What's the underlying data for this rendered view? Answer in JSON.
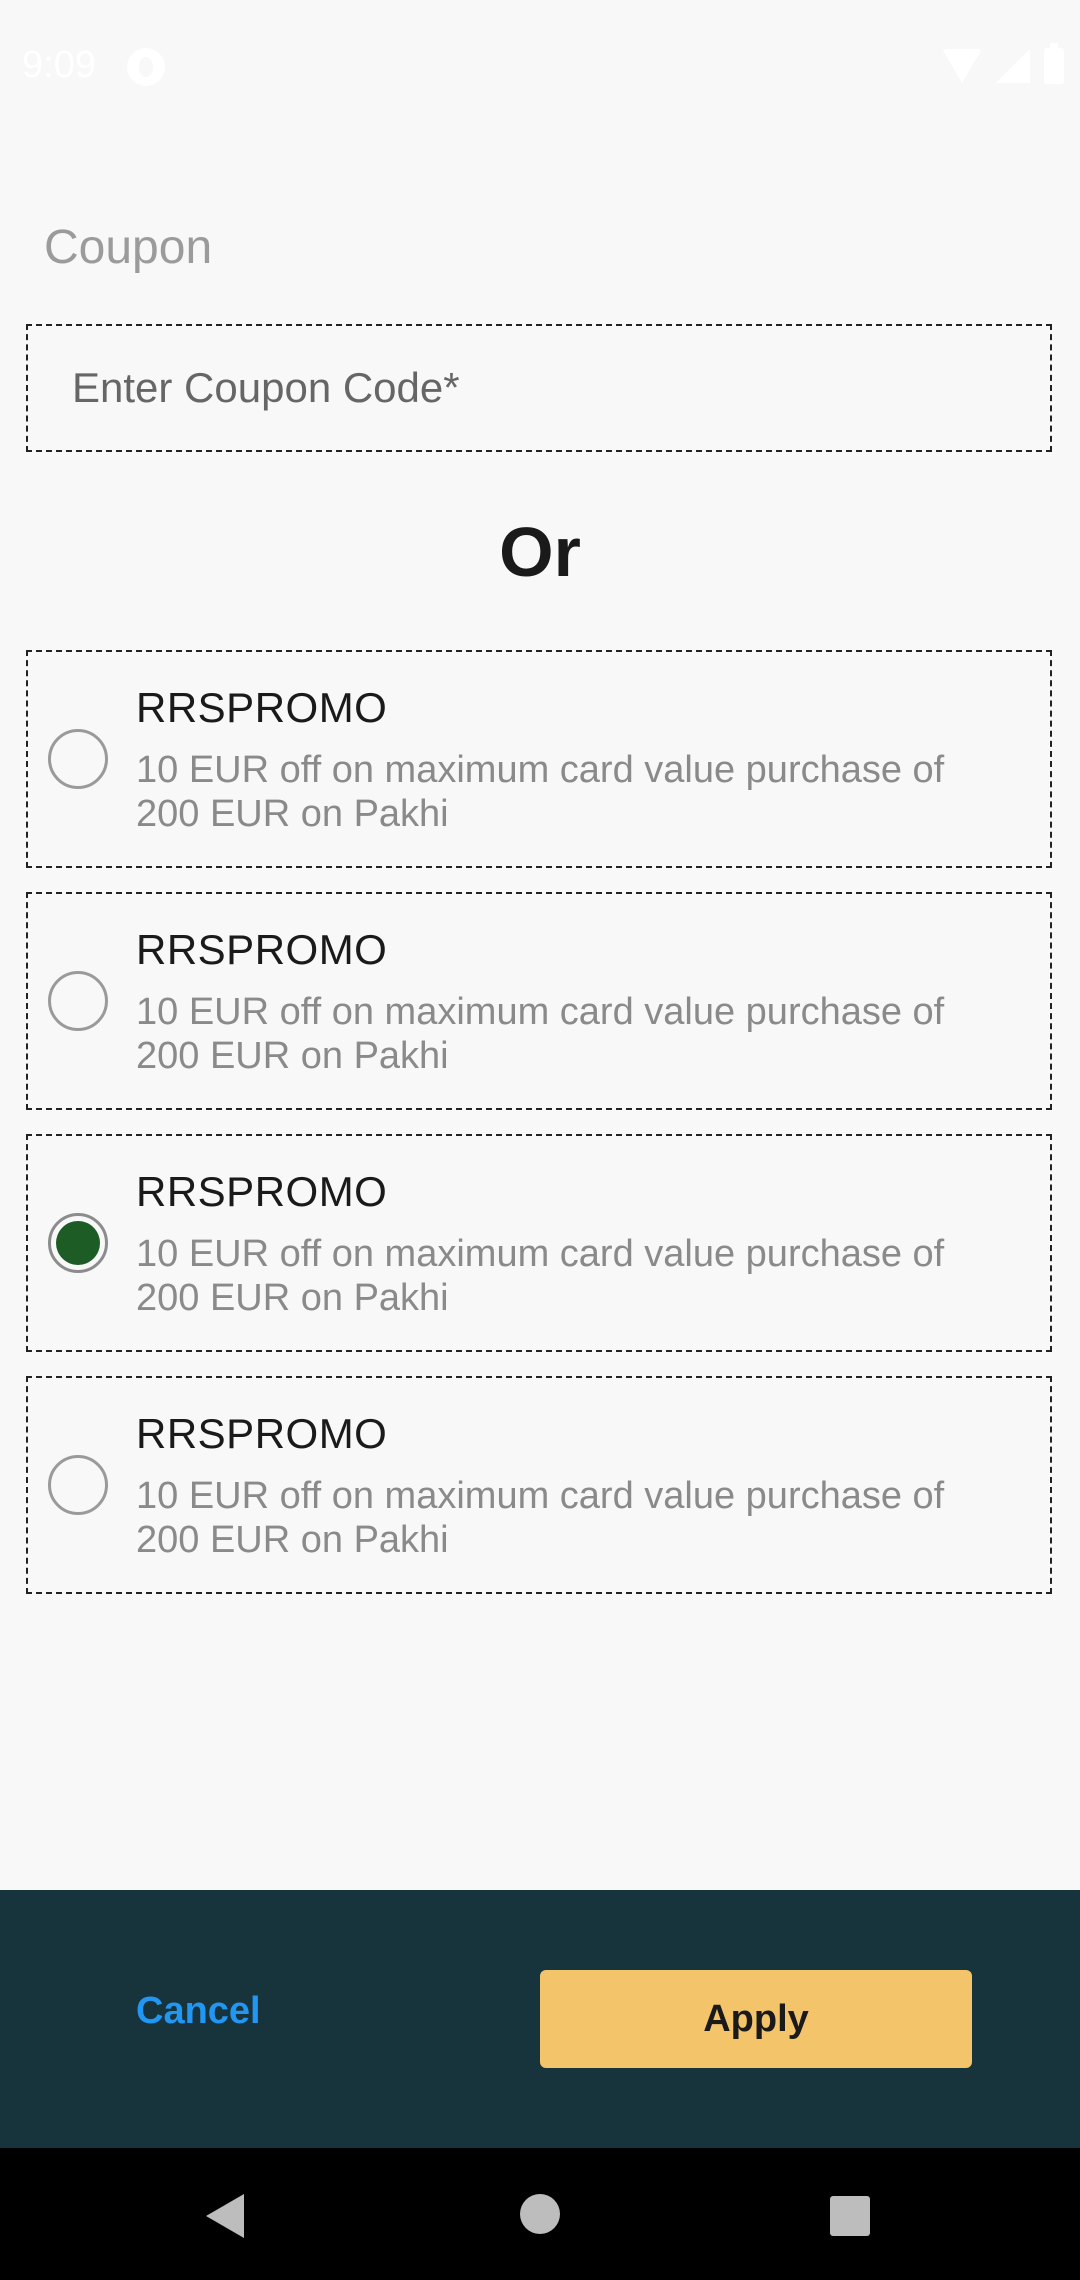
{
  "status_bar": {
    "time": "9:09"
  },
  "title": "Coupon",
  "coupon_input": {
    "value": "",
    "placeholder": "Enter Coupon Code*"
  },
  "or_label": "Or",
  "coupons": [
    {
      "code": "RRSPROMO",
      "description": "10 EUR off on maximum card value purchase of 200 EUR on Pakhi",
      "selected": false
    },
    {
      "code": "RRSPROMO",
      "description": "10 EUR off on maximum card value purchase of 200 EUR on Pakhi",
      "selected": false
    },
    {
      "code": "RRSPROMO",
      "description": "10 EUR off on maximum card value purchase of 200 EUR on Pakhi",
      "selected": true
    },
    {
      "code": "RRSPROMO",
      "description": "10 EUR off on maximum card value purchase of 200 EUR on Pakhi",
      "selected": false
    }
  ],
  "actions": {
    "cancel_label": "Cancel",
    "apply_label": "Apply"
  },
  "colors": {
    "accent_green": "#1d5c24",
    "action_bar_bg": "#17343d",
    "apply_bg": "#f3c46a",
    "cancel_text": "#2196f3"
  },
  "icons": {
    "status": [
      "wifi-icon",
      "signal-icon",
      "battery-icon"
    ],
    "nav": [
      "back-icon",
      "home-icon",
      "recents-icon"
    ]
  }
}
